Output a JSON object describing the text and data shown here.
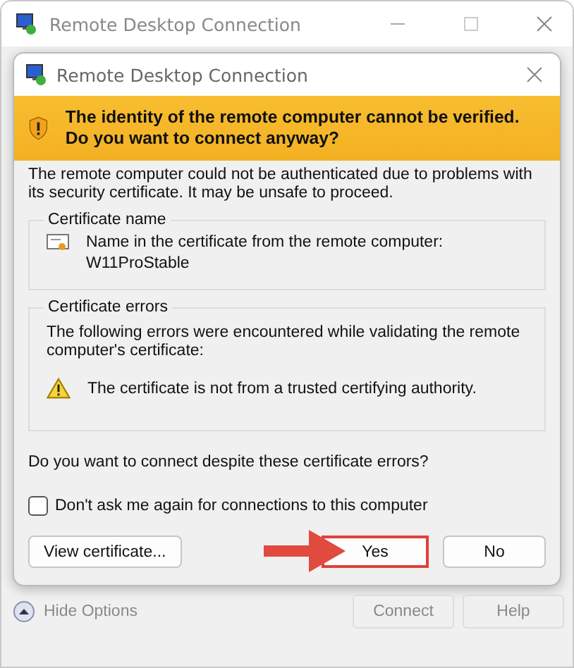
{
  "window": {
    "title": "Remote Desktop Connection"
  },
  "dialog": {
    "title": "Remote Desktop Connection",
    "banner": "The identity of the remote computer cannot be verified. Do you want to connect anyway?",
    "message": "The remote computer could not be authenticated due to problems with its security certificate. It may be unsafe to proceed.",
    "certificate_name": {
      "legend": "Certificate name",
      "label": "Name in the certificate from the remote computer:",
      "value": "W11ProStable"
    },
    "certificate_errors": {
      "legend": "Certificate errors",
      "intro": "The following errors were encountered while validating the remote computer's certificate:",
      "errors": [
        "The certificate is not from a trusted certifying authority."
      ]
    },
    "question": "Do you want to connect despite these certificate errors?",
    "checkbox": {
      "label": "Don't ask me again for connections to this computer",
      "checked": false
    },
    "buttons": [
      {
        "label": "View certificate...",
        "highlighted": false
      },
      {
        "label": "Yes",
        "highlighted": true
      },
      {
        "label": "No",
        "highlighted": false
      }
    ]
  },
  "footer": {
    "options": "Hide Options",
    "buttons": [
      "Connect",
      "Help"
    ]
  }
}
